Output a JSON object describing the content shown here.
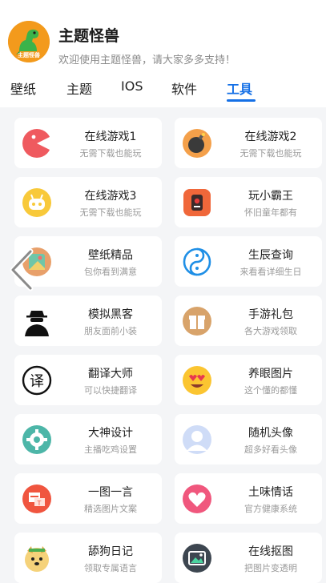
{
  "header": {
    "title": "主题怪兽",
    "subtitle": "欢迎使用主题怪兽，请大家多多支持！",
    "avatar_text": "主题怪兽",
    "avatar_icon": "dinosaur-logo"
  },
  "tabs": [
    {
      "label": "壁纸",
      "active": false
    },
    {
      "label": "主题",
      "active": false
    },
    {
      "label": "IOS",
      "active": false
    },
    {
      "label": "软件",
      "active": false
    },
    {
      "label": "工具",
      "active": true
    }
  ],
  "colors": {
    "accent": "#1570e6",
    "background": "#f4f5f7",
    "card": "#ffffff"
  },
  "tools": [
    {
      "title": "在线游戏1",
      "subtitle": "无需下载也能玩",
      "icon": "pacman-icon"
    },
    {
      "title": "在线游戏2",
      "subtitle": "无需下载也能玩",
      "icon": "bomb-icon"
    },
    {
      "title": "在线游戏3",
      "subtitle": "无需下载也能玩",
      "icon": "robot-face-icon"
    },
    {
      "title": "玩小霸王",
      "subtitle": "怀旧童年都有",
      "icon": "game-console-icon"
    },
    {
      "title": "壁纸精品",
      "subtitle": "包你看到满意",
      "icon": "wallpaper-icon"
    },
    {
      "title": "生辰查询",
      "subtitle": "来看看详细生日",
      "icon": "yin-yang-icon"
    },
    {
      "title": "模拟黑客",
      "subtitle": "朋友面前小装",
      "icon": "hacker-icon"
    },
    {
      "title": "手游礼包",
      "subtitle": "各大游戏领取",
      "icon": "gift-icon"
    },
    {
      "title": "翻译大师",
      "subtitle": "可以快捷翻译",
      "icon": "translate-icon"
    },
    {
      "title": "养眼图片",
      "subtitle": "这个懂的都懂",
      "icon": "heart-eyes-emoji-icon"
    },
    {
      "title": "大神设计",
      "subtitle": "主播吃鸡设置",
      "icon": "settings-gear-icon"
    },
    {
      "title": "随机头像",
      "subtitle": "超多好看头像",
      "icon": "avatar-icon"
    },
    {
      "title": "一图一言",
      "subtitle": "精选图片文案",
      "icon": "image-text-icon"
    },
    {
      "title": "土味情话",
      "subtitle": "官方健康系统",
      "icon": "heart-icon"
    },
    {
      "title": "舔狗日记",
      "subtitle": "领取专属语言",
      "icon": "dog-icon"
    },
    {
      "title": "在线抠图",
      "subtitle": "把图片变透明",
      "icon": "picture-icon"
    }
  ]
}
